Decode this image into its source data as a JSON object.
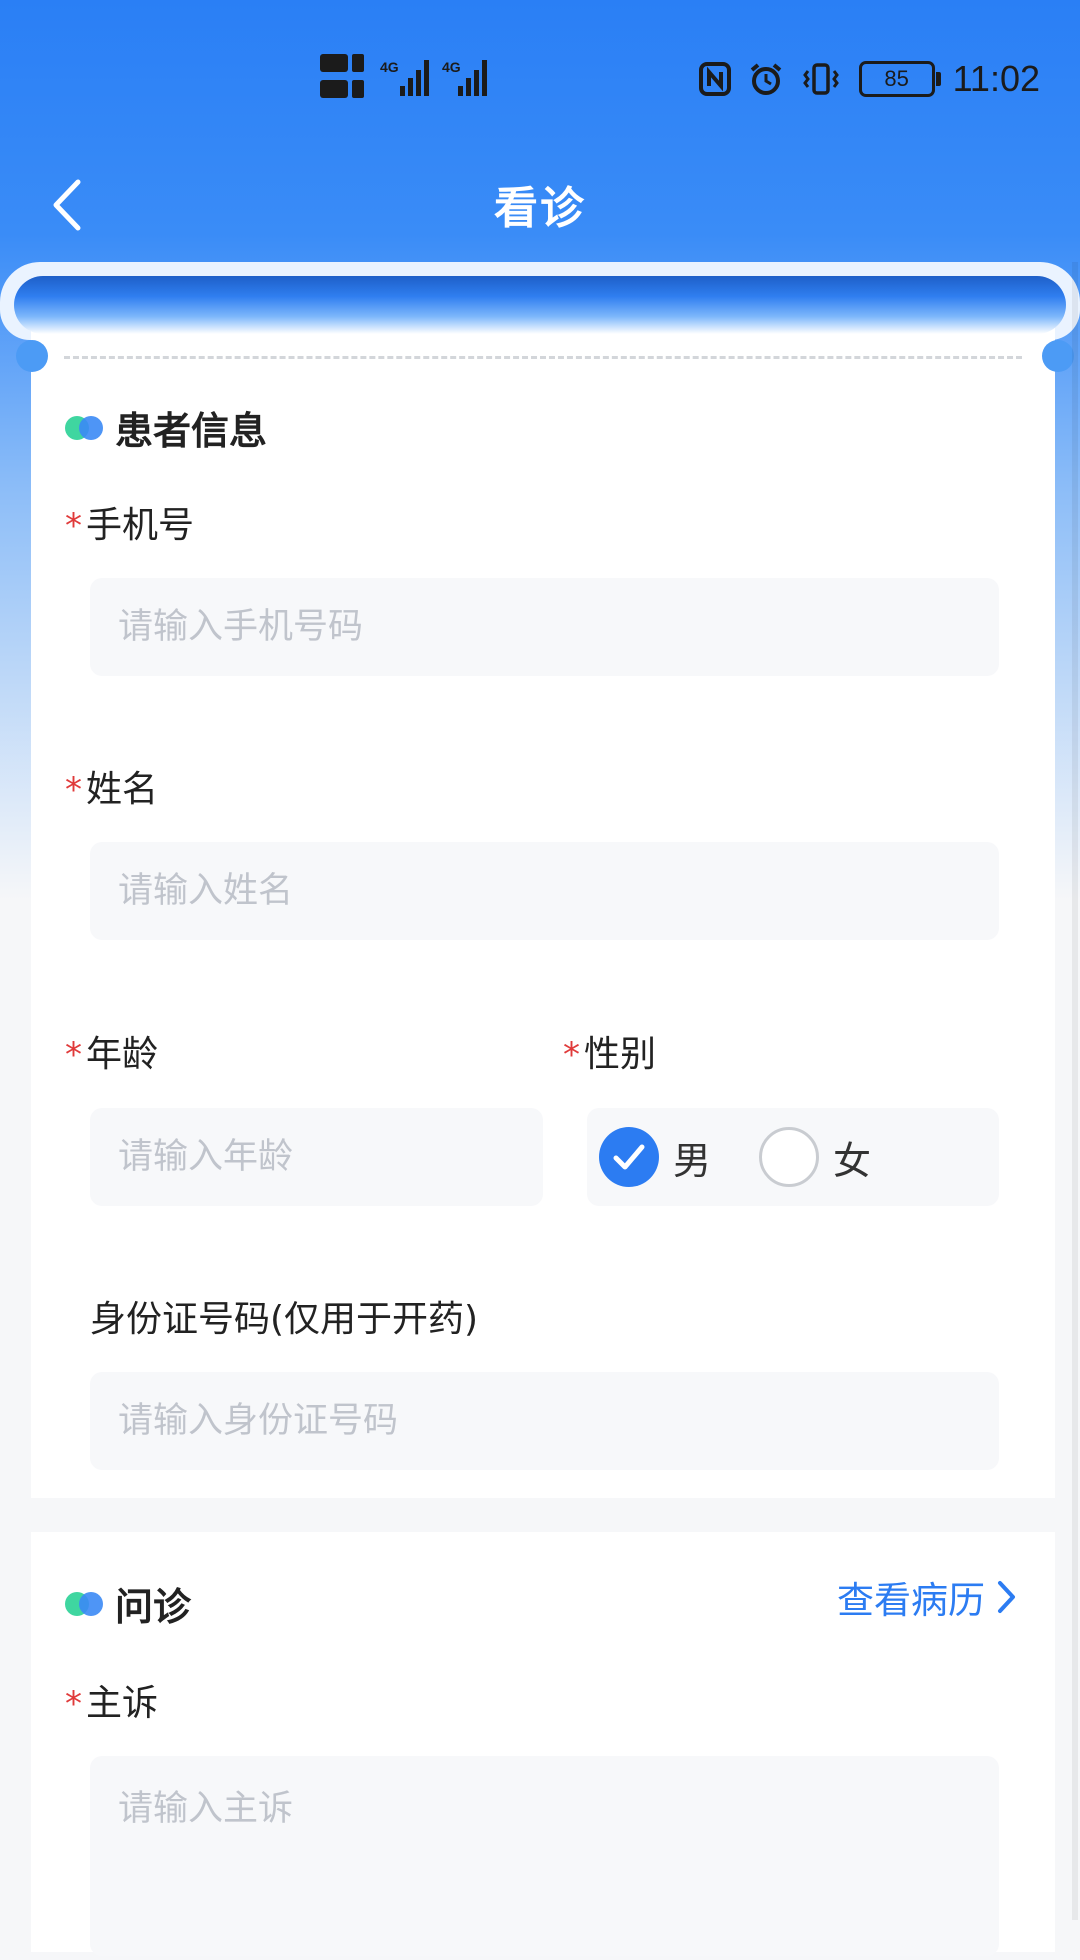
{
  "status_bar": {
    "time": "11:02",
    "battery": "85",
    "icons": [
      "hd-sim-icon",
      "signal-4g-icon",
      "nfc-icon",
      "alarm-icon",
      "vibrate-icon",
      "battery-icon"
    ]
  },
  "nav": {
    "title": "看诊",
    "back_icon": "chevron-left-icon"
  },
  "patient_section": {
    "title": "患者信息",
    "phone": {
      "required": "*",
      "label": "手机号",
      "value": "",
      "placeholder": "请输入手机号码"
    },
    "name": {
      "required": "*",
      "label": "姓名",
      "value": "",
      "placeholder": "请输入姓名"
    },
    "age": {
      "required": "*",
      "label": "年龄",
      "value": "",
      "placeholder": "请输入年龄"
    },
    "gender": {
      "required": "*",
      "label": "性别",
      "options": [
        {
          "label": "男",
          "selected": true
        },
        {
          "label": "女",
          "selected": false
        }
      ]
    },
    "id_card": {
      "label": "身份证号码(仅用于开药)",
      "value": "",
      "placeholder": "请输入身份证号码"
    }
  },
  "consult_section": {
    "title": "问诊",
    "history_link": "查看病历",
    "complaint": {
      "required": "*",
      "label": "主诉",
      "value": "",
      "placeholder": "请输入主诉"
    }
  },
  "colors": {
    "primary": "#2C7CF2",
    "header": "#2A7FF5",
    "required": "#E03A3A",
    "dot_green": "#3FD6A0",
    "placeholder": "#C0C4CC",
    "input_bg": "#F7F8FA"
  }
}
